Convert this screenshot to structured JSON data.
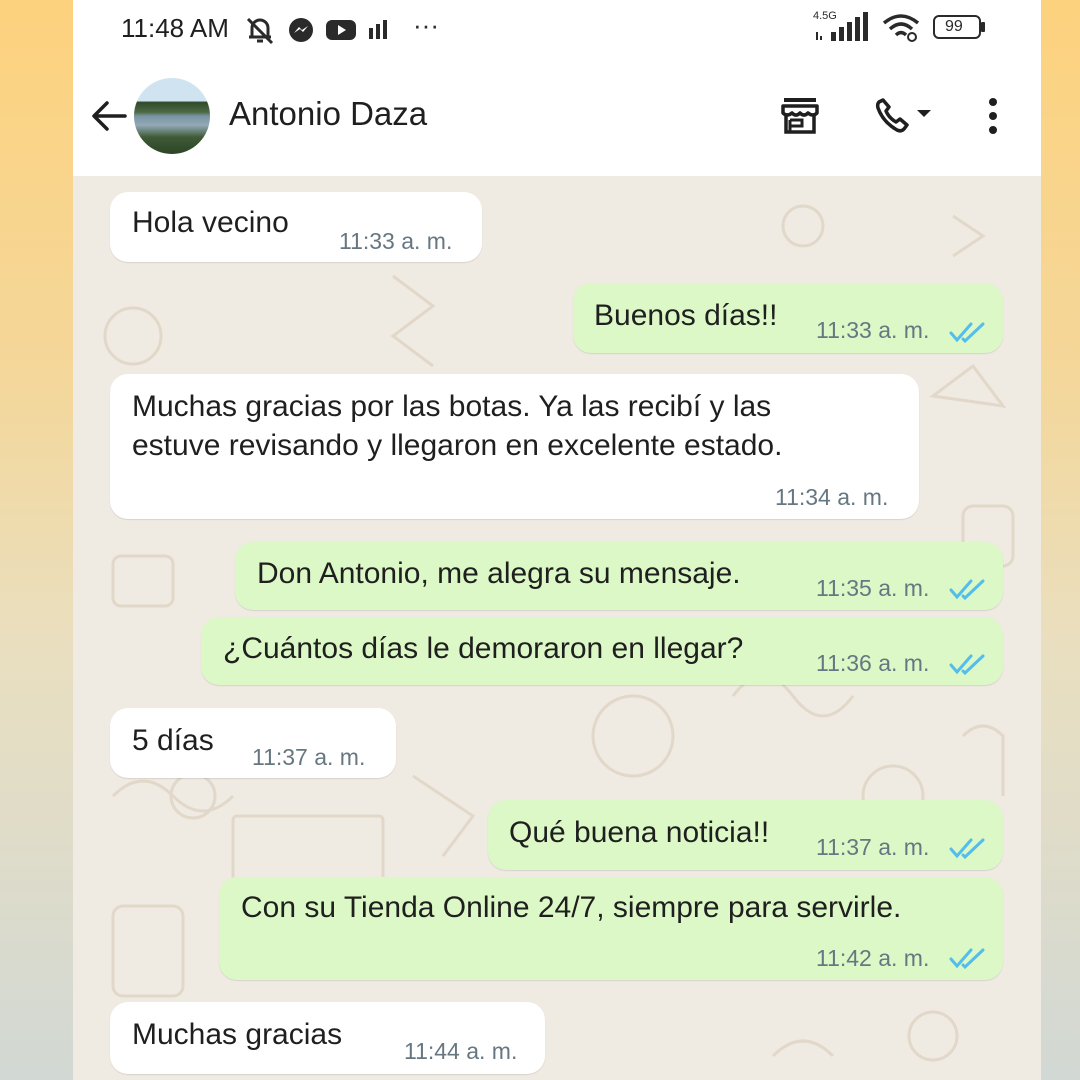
{
  "status_bar": {
    "time": "11:48 AM",
    "dots": "···",
    "network": "4.5G",
    "battery": "99"
  },
  "header": {
    "contact_name": "Antonio Daza"
  },
  "messages": [
    {
      "dir": "in",
      "text": "Hola vecino",
      "time": "11:33 a. m."
    },
    {
      "dir": "out",
      "text": "Buenos días!!",
      "time": "11:33 a. m."
    },
    {
      "dir": "in",
      "text_line1": "Muchas gracias por las botas. Ya las recibí y las",
      "text_line2": "estuve revisando y llegaron en excelente estado.",
      "time": "11:34 a. m."
    },
    {
      "dir": "out",
      "text": "Don Antonio, me alegra su mensaje.",
      "time": "11:35 a. m."
    },
    {
      "dir": "out",
      "text": "¿Cuántos días le demoraron en llegar?",
      "time": "11:36 a. m."
    },
    {
      "dir": "in",
      "text": "5 días",
      "time": "11:37 a. m."
    },
    {
      "dir": "out",
      "text": "Qué buena noticia!!",
      "time": "11:37 a. m."
    },
    {
      "dir": "out",
      "text": "Con su Tienda Online 24/7, siempre para servirle.",
      "time": "11:42 a. m."
    },
    {
      "dir": "in",
      "text": "Muchas gracias",
      "time": "11:44 a. m."
    }
  ],
  "colors": {
    "incoming_bubble": "#ffffff",
    "outgoing_bubble": "#dbf8c6",
    "read_ticks": "#53bdeb",
    "chat_background": "#efeae2"
  }
}
